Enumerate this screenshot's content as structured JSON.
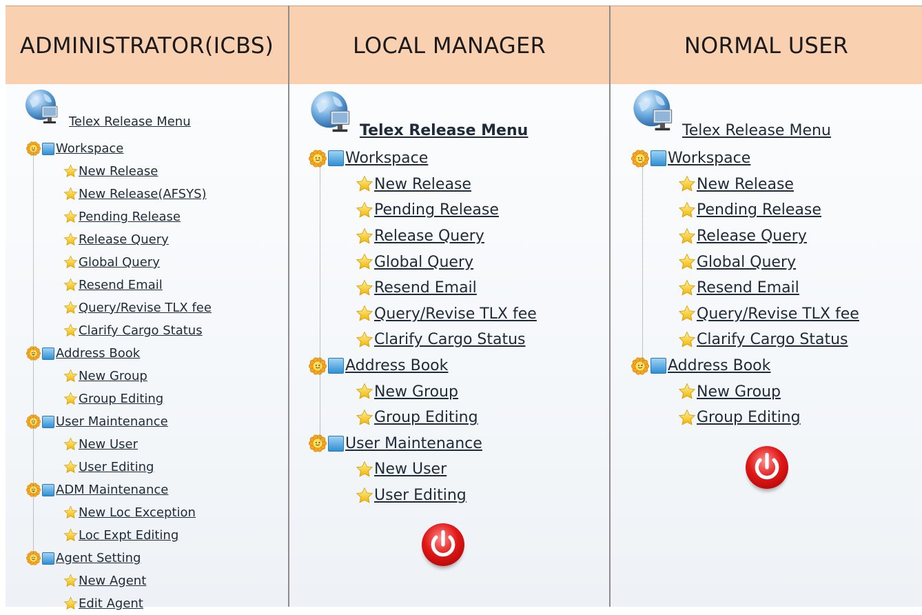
{
  "columns": [
    {
      "header": "ADMINISTRATOR(ICBS)",
      "menu_title": "Telex Release Menu",
      "groups": [
        {
          "label": "Workspace",
          "items": [
            "New Release",
            "New Release(AFSYS)",
            "Pending Release",
            "Release Query",
            "Global Query",
            "Resend Email",
            "Query/Revise TLX fee",
            "Clarify Cargo Status"
          ]
        },
        {
          "label": "Address Book",
          "items": [
            "New Group",
            "Group Editing"
          ]
        },
        {
          "label": "User Maintenance",
          "items": [
            "New User",
            "User Editing"
          ]
        },
        {
          "label": "ADM Maintenance",
          "items": [
            "New Loc Exception",
            "Loc Expt Editing"
          ]
        },
        {
          "label": "Agent Setting",
          "items": [
            "New Agent",
            "Edit Agent"
          ]
        }
      ]
    },
    {
      "header": "LOCAL MANAGER",
      "menu_title": "Telex Release Menu",
      "groups": [
        {
          "label": "Workspace",
          "items": [
            "New Release",
            "Pending Release",
            "Release Query",
            "Global Query",
            "Resend Email",
            "Query/Revise TLX fee",
            "Clarify Cargo Status"
          ]
        },
        {
          "label": "Address Book",
          "items": [
            "New Group",
            "Group Editing"
          ]
        },
        {
          "label": "User Maintenance",
          "items": [
            "New User",
            "User Editing"
          ]
        }
      ],
      "logout_icon": "power-icon"
    },
    {
      "header": "NORMAL USER",
      "menu_title": "Telex Release Menu",
      "groups": [
        {
          "label": "Workspace",
          "items": [
            "New Release",
            "Pending Release",
            "Release Query",
            "Global Query",
            "Resend Email",
            "Query/Revise TLX fee",
            "Clarify Cargo Status"
          ]
        },
        {
          "label": "Address Book",
          "items": [
            "New Group",
            "Group Editing"
          ]
        }
      ],
      "logout_icon": "power-icon"
    }
  ],
  "icons": {
    "root": "globe-computer-icon",
    "group": "sun-folder-icon",
    "item": "star-icon"
  },
  "colors": {
    "header_bg": "#f9d1b0",
    "link_text": "#1f2b38",
    "power_red": "#e01818"
  }
}
